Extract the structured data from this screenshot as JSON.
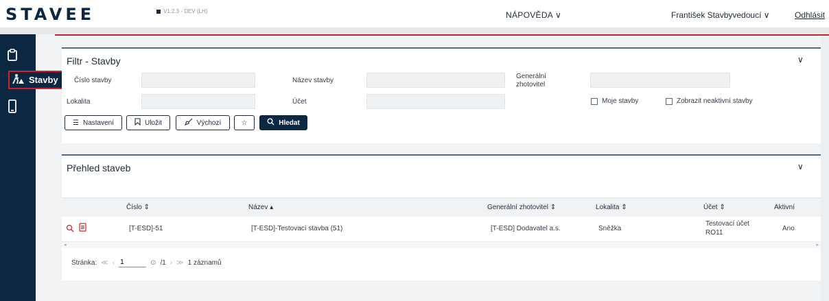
{
  "header": {
    "logo": "STAVEE",
    "version": "V1.2.3 - DEV (LH)",
    "help_label": "NÁPOVĚDA ∨",
    "user_label": "František Stavbyvedoucí ∨",
    "logout_label": "Odhlásit"
  },
  "sidebar": {
    "active_item": "Stavby",
    "icons": [
      "clipboard-icon",
      "construction-worker-icon",
      "mobile-icon"
    ],
    "accent_color": "#d12127"
  },
  "filter": {
    "title": "Filtr - Stavby",
    "fields": {
      "cislo_label": "Číslo stavby",
      "nazev_label": "Název stavby",
      "gen_label_1": "Generální",
      "gen_label_2": "zhotovitel",
      "lokalita_label": "Lokalita",
      "ucet_label": "Účet"
    },
    "checkboxes": {
      "moje": "Moje stavby",
      "neaktivni": "Zobrazit neaktivní stavby"
    },
    "buttons": {
      "nastaveni": "Nastavení",
      "ulozit": "Uložit",
      "vychozi": "Výchozí",
      "hledat": "Hledat"
    }
  },
  "overview": {
    "title": "Přehled staveb",
    "columns": [
      "Číslo ⇕",
      "Název ▴",
      "Generální zhotovitel ⇕",
      "Lokalita ⇕",
      "Účet ⇕",
      "Aktivní"
    ],
    "rows": [
      {
        "cislo": "[T-ESD]-51",
        "nazev": "[T-ESD]-Testovací stavba (51)",
        "zhotovitel": "[T-ESD] Dodavatel a.s.",
        "lokalita": "Sněžka",
        "ucet_1": "Testovací účet",
        "ucet_2": "RO11",
        "aktivni": "Ano"
      }
    ],
    "pager": {
      "label": "Stránka:",
      "first": "≪",
      "prev": "‹",
      "page_value": "1",
      "total": "/1",
      "next": "›",
      "last": "≫",
      "count": "1 záznamů"
    }
  }
}
